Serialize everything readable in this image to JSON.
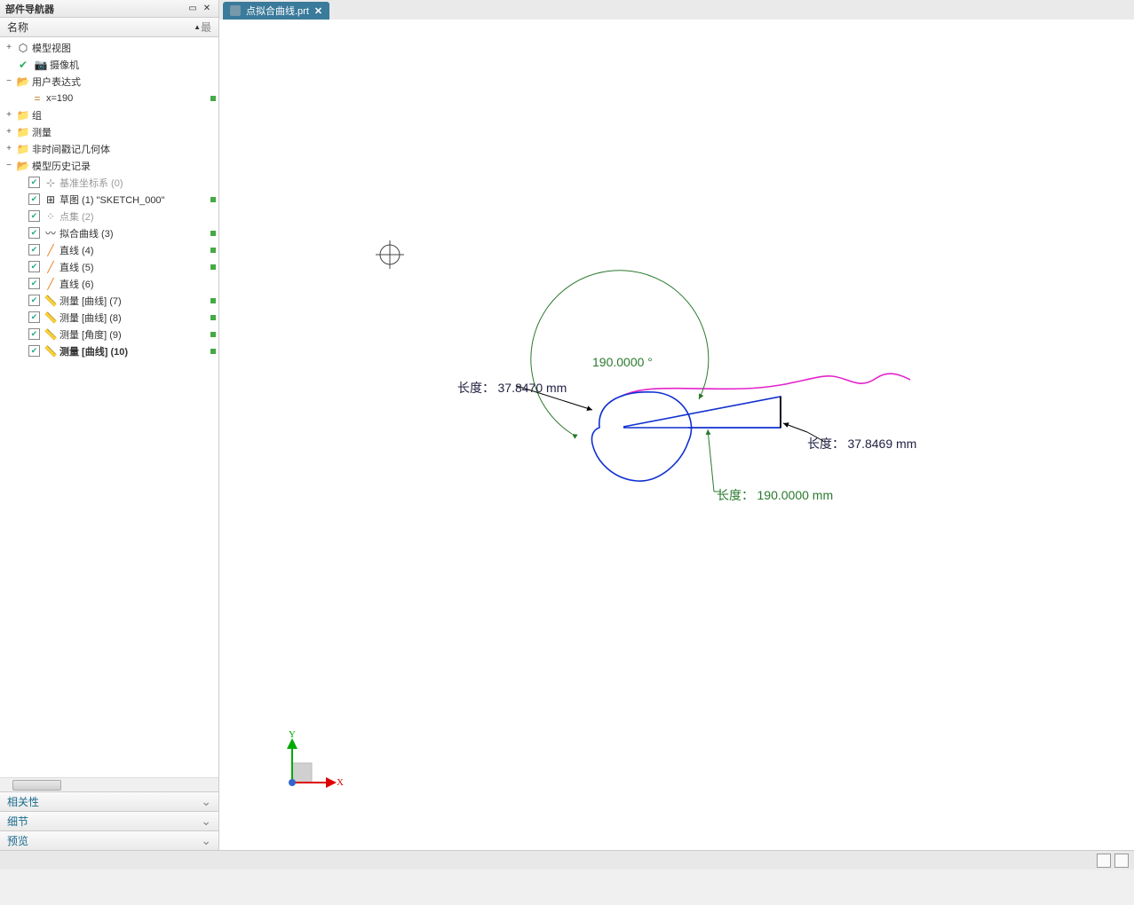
{
  "sidebar": {
    "title": "部件导航器",
    "col_name": "名称",
    "col_last": "最",
    "panels": {
      "related": "相关性",
      "detail": "细节",
      "preview": "预览"
    }
  },
  "tree": {
    "model_view": "模型视图",
    "camera": "摄像机",
    "user_expr": "用户表达式",
    "x_expr": "x=190",
    "group": "组",
    "measure": "测量",
    "non_time_geo": "非时间戳记几何体",
    "history": "模型历史记录",
    "datum": "基准坐标系 (0)",
    "sketch": "草图 (1) \"SKETCH_000\"",
    "pointset": "点集 (2)",
    "fit_curve": "拟合曲线 (3)",
    "line4": "直线 (4)",
    "line5": "直线 (5)",
    "line6": "直线 (6)",
    "meas7": "测量 [曲线] (7)",
    "meas8": "测量 [曲线] (8)",
    "meas9": "测量 [角度] (9)",
    "meas10": "测量 [曲线] (10)"
  },
  "tab": {
    "filename": "点拟合曲线.prt"
  },
  "ann": {
    "angle": "190.0000 °",
    "len1_label": "长度：",
    "len1_val": "37.8470 mm",
    "len2_label": "长度：",
    "len2_val": "190.0000 mm",
    "len3_label": "长度：",
    "len3_val": "37.8469 mm"
  },
  "axes": {
    "x": "X",
    "y": "Y"
  }
}
